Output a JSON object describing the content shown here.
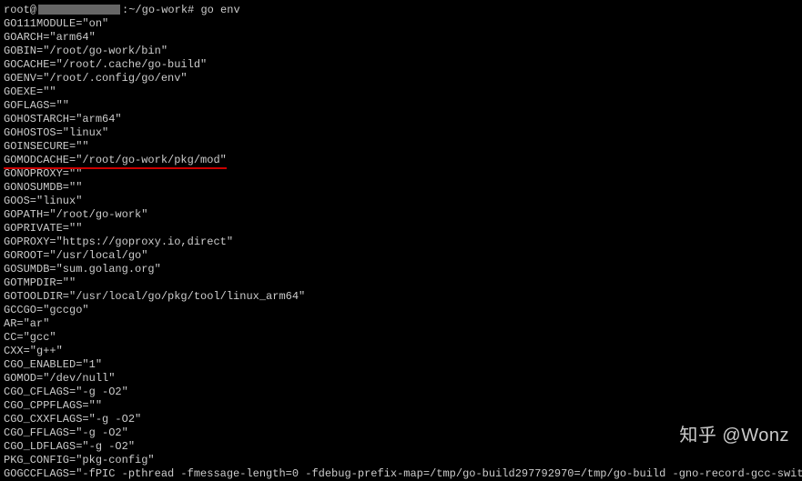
{
  "prompt": {
    "user": "root@",
    "path": ":~/go-work#",
    "command": "go env"
  },
  "env_output": [
    "GO111MODULE=\"on\"",
    "GOARCH=\"arm64\"",
    "GOBIN=\"/root/go-work/bin\"",
    "GOCACHE=\"/root/.cache/go-build\"",
    "GOENV=\"/root/.config/go/env\"",
    "GOEXE=\"\"",
    "GOFLAGS=\"\"",
    "GOHOSTARCH=\"arm64\"",
    "GOHOSTOS=\"linux\"",
    "GOINSECURE=\"\"",
    "GOMODCACHE=\"/root/go-work/pkg/mod\"",
    "GONOPROXY=\"\"",
    "GONOSUMDB=\"\"",
    "GOOS=\"linux\"",
    "GOPATH=\"/root/go-work\"",
    "GOPRIVATE=\"\"",
    "GOPROXY=\"https://goproxy.io,direct\"",
    "GOROOT=\"/usr/local/go\"",
    "GOSUMDB=\"sum.golang.org\"",
    "GOTMPDIR=\"\"",
    "GOTOOLDIR=\"/usr/local/go/pkg/tool/linux_arm64\"",
    "GCCGO=\"gccgo\"",
    "AR=\"ar\"",
    "CC=\"gcc\"",
    "CXX=\"g++\"",
    "CGO_ENABLED=\"1\"",
    "GOMOD=\"/dev/null\"",
    "CGO_CFLAGS=\"-g -O2\"",
    "CGO_CPPFLAGS=\"\"",
    "CGO_CXXFLAGS=\"-g -O2\"",
    "CGO_FFLAGS=\"-g -O2\"",
    "CGO_LDFLAGS=\"-g -O2\"",
    "PKG_CONFIG=\"pkg-config\"",
    "GOGCCFLAGS=\"-fPIC -pthread -fmessage-length=0 -fdebug-prefix-map=/tmp/go-build297792970=/tmp/go-build -gno-record-gcc-switches\""
  ],
  "highlighted_index": 10,
  "watermark": "知乎 @Wonz"
}
